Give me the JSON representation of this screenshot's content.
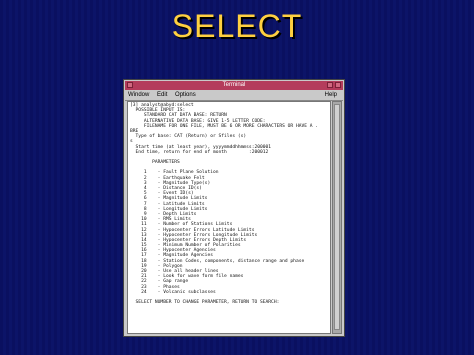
{
  "slide": {
    "title": "SELECT"
  },
  "terminal": {
    "title": "Terminal",
    "menu": {
      "window": "Window",
      "edit": "Edit",
      "options": "Options",
      "help": "Help"
    },
    "lines": [
      "[3] analyst@abyd:select",
      "  POSSIBLE INPUT IS:",
      "     STANDARD CAT DATA BASE: RETURN",
      "     ALTERNATIVE DATA BASE: GIVE 1-5 LETTER CODE:",
      "     FILENAME FOR ONE FILE, MUST BE 6 OR MORE CHARACTERS OR HAVE A .",
      "BRE",
      "  Type of base: CAT (Return) or Sfiles (s)",
      "s",
      "  Start time (at least year), yyyymmddhhmmss:200001",
      "  End time, return for end of month        :200012",
      "",
      "        PARAMETERS",
      "",
      "     1    - Fault Plane Solution",
      "     2    - Earthquake Felt",
      "     3    - Magnitude Type(s)",
      "     4    - Distance ID(s)",
      "     5    - Event ID(s)",
      "     6    - Magnitude Limits",
      "     7    - Latitude Limits",
      "     8    - Longitude Limits",
      "     9    - Depth Limits",
      "    10    - RMS Limits",
      "    11    - Number of Stations Limits",
      "    12    - Hypocenter Errors Latitude Limits",
      "    13    - Hypocenter Errors Longitude Limits",
      "    14    - Hypocenter Errors Depth Limits",
      "    15    - Minimum Number of Polarities",
      "    16    - Hypocenter Agencies",
      "    17    - Magnitude Agencies",
      "    18    - Station Codes, components, distance range and phase",
      "    19    - Polygon",
      "    20    - Use all header lines",
      "    21    - Look for wave form file names",
      "    22    - Gap range",
      "    23    - Phases",
      "    24    - Volcanic subclasses",
      "",
      "  SELECT NUMBER TO CHANGE PARAMETER, RETURN TO SEARCH:",
      ""
    ]
  },
  "colors": {
    "background": "#0a1060",
    "title": "#ffd040",
    "titlebar": "#b43c5c",
    "window": "#c9c9c9"
  }
}
